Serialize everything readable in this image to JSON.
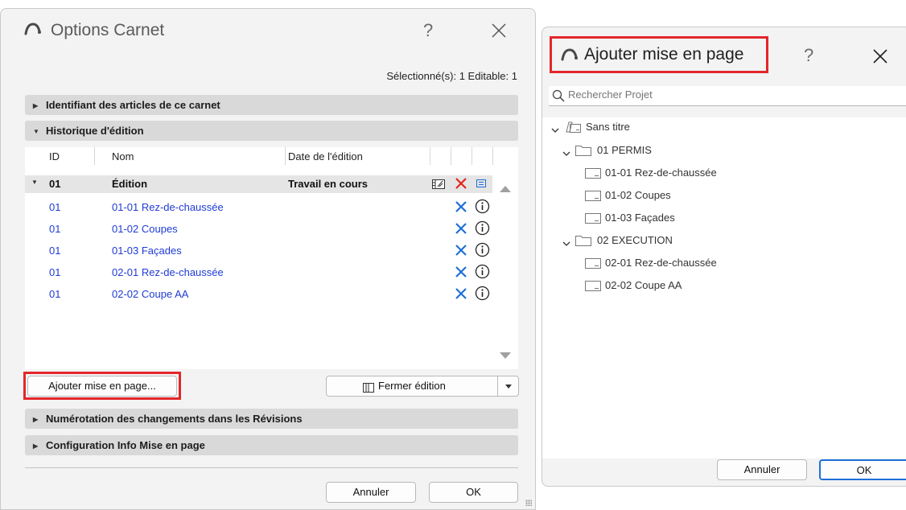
{
  "options_dialog": {
    "title": "Options Carnet",
    "help_label": "?",
    "selection_info": "Sélectionné(s): 1 Editable: 1",
    "sections": {
      "identifier": "Identifiant des articles de ce carnet",
      "history": "Historique d'édition",
      "numbering": "Numérotation des changements dans les Révisions",
      "layout_info": "Configuration Info Mise en page"
    },
    "table": {
      "headers": {
        "id": "ID",
        "name": "Nom",
        "date": "Date de l'édition"
      },
      "edition_row": {
        "id": "01",
        "name": "Édition",
        "date": "Travail en cours"
      },
      "rows": [
        {
          "id": "01",
          "name": "01-01 Rez-de-chaussée"
        },
        {
          "id": "01",
          "name": "01-02 Coupes"
        },
        {
          "id": "01",
          "name": "01-03 Façades"
        },
        {
          "id": "01",
          "name": "02-01 Rez-de-chaussée"
        },
        {
          "id": "01",
          "name": "02-02 Coupe AA"
        }
      ]
    },
    "add_layout_button": "Ajouter mise en page...",
    "close_edition_button": "Fermer édition",
    "cancel_button": "Annuler",
    "ok_button": "OK"
  },
  "add_layout_dialog": {
    "title": "Ajouter mise en page",
    "help_label": "?",
    "search_placeholder": "Rechercher Projet",
    "tree": {
      "root": "Sans titre",
      "folders": [
        {
          "name": "01 PERMIS",
          "items": [
            "01-01 Rez-de-chaussée",
            "01-02 Coupes",
            "01-03 Façades"
          ]
        },
        {
          "name": "02 EXECUTION",
          "items": [
            "02-01 Rez-de-chaussée",
            "02-02 Coupe AA"
          ]
        }
      ]
    },
    "cancel_button": "Annuler",
    "ok_button": "OK"
  },
  "colors": {
    "link_blue": "#1f3bd6",
    "highlight_red": "#e3262a",
    "delete_red": "#e0261c",
    "accent_blue": "#1f6fd6"
  },
  "icons": {
    "logo": "archicad-arc-icon",
    "close": "close-icon",
    "delete": "delete-x-icon",
    "info": "info-icon",
    "search": "search-icon",
    "folder": "folder-icon",
    "layout": "layout-sheet-icon"
  }
}
